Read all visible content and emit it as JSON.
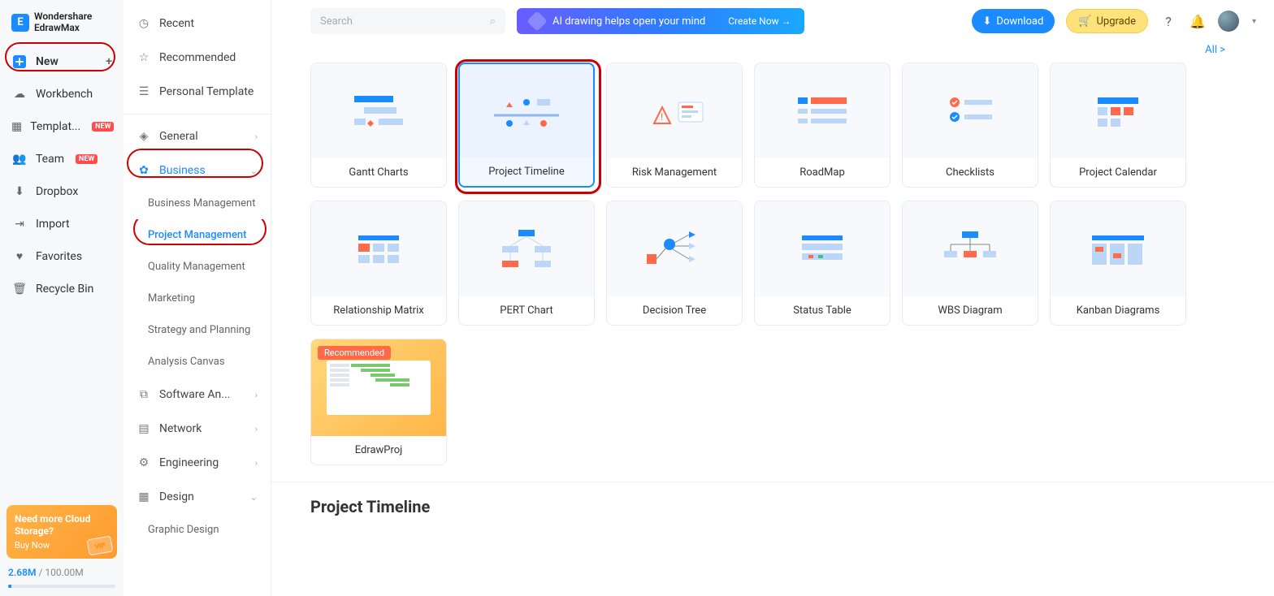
{
  "app": {
    "name": "Wondershare\nEdrawMax"
  },
  "sidebar": {
    "new": "New",
    "workbench": "Workbench",
    "templates": "Templat...",
    "team": "Team",
    "dropbox": "Dropbox",
    "import": "Import",
    "favorites": "Favorites",
    "recycle": "Recycle Bin",
    "badge_new": "NEW"
  },
  "storage": {
    "title": "Need more Cloud Storage?",
    "buy": "Buy Now",
    "used": "2.68M",
    "total": " / 100.00M"
  },
  "panel": {
    "recent": "Recent",
    "recommended": "Recommended",
    "personal": "Personal Template",
    "general": "General",
    "business": "Business",
    "sub": {
      "bm": "Business Management",
      "pm": "Project Management",
      "qm": "Quality Management",
      "mk": "Marketing",
      "sp": "Strategy and Planning",
      "ac": "Analysis Canvas"
    },
    "software": "Software An...",
    "network": "Network",
    "engineering": "Engineering",
    "design": "Design",
    "graphic": "Graphic Design"
  },
  "top": {
    "search_ph": "Search",
    "ai": "AI drawing helps open your mind",
    "ai_cta": "Create Now  →",
    "download": "Download",
    "upgrade": "Upgrade",
    "all": "All >"
  },
  "cards": {
    "gantt": "Gantt Charts",
    "timeline": "Project Timeline",
    "risk": "Risk Management",
    "roadmap": "RoadMap",
    "checklists": "Checklists",
    "calendar": "Project Calendar",
    "matrix": "Relationship Matrix",
    "pert": "PERT Chart",
    "decision": "Decision Tree",
    "status": "Status Table",
    "wbs": "WBS Diagram",
    "kanban": "Kanban Diagrams",
    "edrawproj": "EdrawProj",
    "recommended": "Recommended"
  },
  "section": {
    "timeline": "Project Timeline"
  }
}
